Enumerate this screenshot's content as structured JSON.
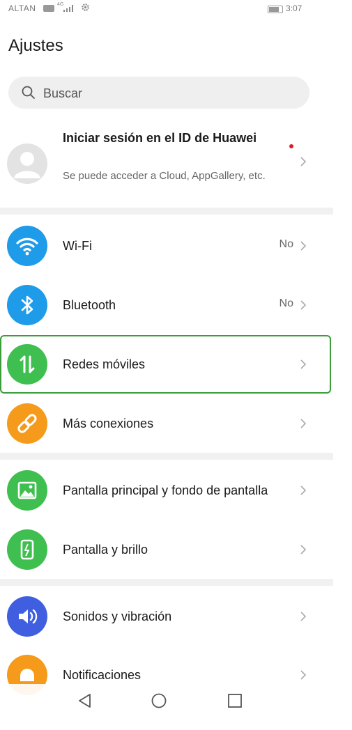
{
  "status_bar": {
    "carrier": "ALTAN",
    "network": "4G",
    "time": "3:07"
  },
  "header": {
    "title": "Ajustes"
  },
  "search": {
    "placeholder": "Buscar"
  },
  "account": {
    "title": "Iniciar sesión en el ID de Huawei",
    "subtitle": "Se puede acceder a Cloud, AppGallery, etc."
  },
  "settings": {
    "wifi": {
      "label": "Wi-Fi",
      "value": "No",
      "icon": "wifi-icon",
      "color": "#1e9be9"
    },
    "bluetooth": {
      "label": "Bluetooth",
      "value": "No",
      "icon": "bluetooth-icon",
      "color": "#1e9be9"
    },
    "mobile": {
      "label": "Redes móviles",
      "icon": "mobile-data-icon",
      "color": "#3fbf4f"
    },
    "more": {
      "label": "Más conexiones",
      "icon": "link-icon",
      "color": "#f59a1b"
    },
    "home": {
      "label": "Pantalla principal y fondo de pantalla",
      "icon": "wallpaper-icon",
      "color": "#3fbf4f"
    },
    "display": {
      "label": "Pantalla y brillo",
      "icon": "brightness-icon",
      "color": "#3fbf4f"
    },
    "sound": {
      "label": "Sonidos y vibración",
      "icon": "speaker-icon",
      "color": "#3f5fe0"
    },
    "notif": {
      "label": "Notificaciones",
      "icon": "bell-icon",
      "color": "#f59a1b"
    }
  }
}
